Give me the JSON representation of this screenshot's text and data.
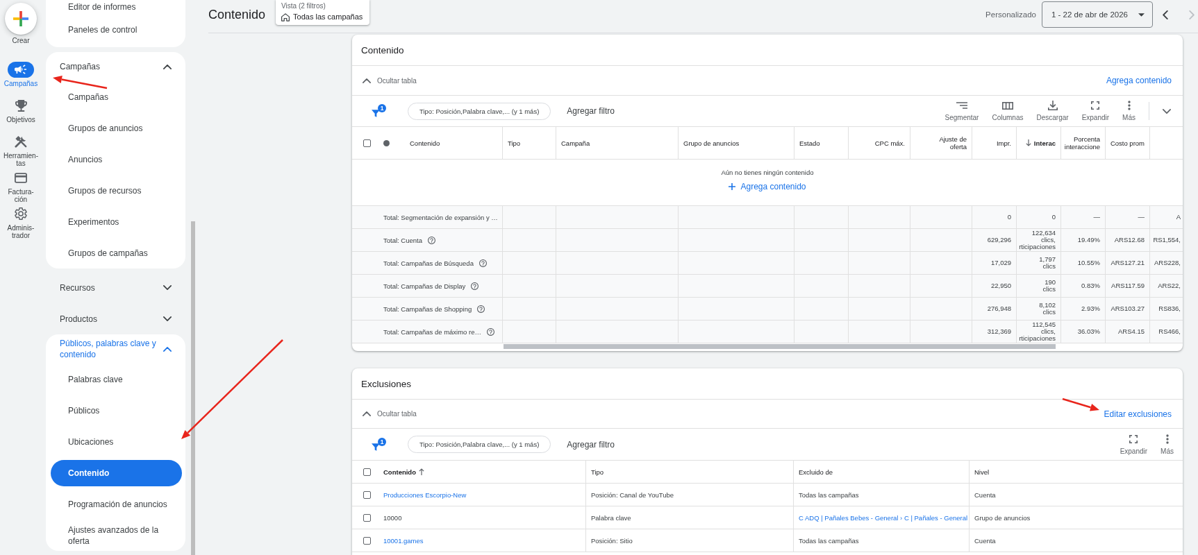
{
  "rail": {
    "create": {
      "label": "Crear"
    },
    "items": [
      {
        "kind": "campaigns",
        "label": "Campañas",
        "selected": true
      },
      {
        "kind": "goals",
        "label": "Objetivos",
        "selected": false
      },
      {
        "kind": "tools",
        "label": "Herramien-\ntas",
        "selected": false
      },
      {
        "kind": "billing",
        "label": "Factura-\nción",
        "selected": false
      },
      {
        "kind": "admin",
        "label": "Adminis-\ntrador",
        "selected": false
      }
    ]
  },
  "sidebar": {
    "sections": [
      {
        "expanded": true,
        "items": [
          {
            "label": "Editor de informes",
            "selected": false
          },
          {
            "label": "Paneles de control",
            "selected": false
          }
        ]
      },
      {
        "label": "Campañas",
        "expanded": true,
        "active": false,
        "items": [
          {
            "label": "Campañas",
            "selected": false
          },
          {
            "label": "Grupos de anuncios",
            "selected": false
          },
          {
            "label": "Anuncios",
            "selected": false
          },
          {
            "label": "Grupos de recursos",
            "selected": false
          },
          {
            "label": "Experimentos",
            "selected": false
          },
          {
            "label": "Grupos de campañas",
            "selected": false
          }
        ]
      },
      {
        "label": "Recursos",
        "expanded": false,
        "active": false
      },
      {
        "label": "Productos",
        "expanded": false,
        "active": false
      },
      {
        "label": "Públicos, palabras clave y contenido",
        "expanded": true,
        "active": true,
        "items": [
          {
            "label": "Palabras clave",
            "selected": false
          },
          {
            "label": "Públicos",
            "selected": false
          },
          {
            "label": "Ubicaciones",
            "selected": false
          },
          {
            "label": "Contenido",
            "selected": true
          },
          {
            "label": "Programación de anuncios",
            "selected": false
          },
          {
            "label": "Ajustes avanzados de la oferta",
            "selected": false
          }
        ]
      }
    ]
  },
  "header": {
    "title": "Contenido",
    "view": {
      "caption": "Vista (2 filtros)",
      "value": "Todas las campañas"
    },
    "date": {
      "preset": "Personalizado",
      "range": "1 - 22 de abr de 2026"
    },
    "prev": {
      "disabled": false
    },
    "next": {
      "disabled": true
    }
  },
  "content_table": {
    "title": "Contenido",
    "toggle": {
      "label": "Ocultar tabla",
      "expanded": true
    },
    "action": "Agrega contenido",
    "filter": {
      "count": "1",
      "chip": "Tipo: Posición,Palabra clave,... (y 1 más)",
      "add": "Agregar filtro"
    },
    "tools": [
      {
        "kind": "segment",
        "label": "Segmentar"
      },
      {
        "kind": "columns",
        "label": "Columnas"
      },
      {
        "kind": "download",
        "label": "Descargar"
      },
      {
        "kind": "expand",
        "label": "Expandir"
      },
      {
        "kind": "more",
        "label": "Más"
      }
    ],
    "select_all": {
      "checked": false
    },
    "columns": [
      {
        "label": "Contenido",
        "kind": "text",
        "sorted": false
      },
      {
        "label": "Tipo",
        "kind": "text",
        "sorted": false
      },
      {
        "label": "Campaña",
        "kind": "text",
        "sorted": false
      },
      {
        "label": "Grupo de anuncios",
        "kind": "text",
        "sorted": false
      },
      {
        "label": "Estado",
        "kind": "text",
        "sorted": false
      },
      {
        "label": "CPC máx.",
        "kind": "metric",
        "sorted": false
      },
      {
        "label": "Ajuste de\noferta",
        "kind": "metric",
        "sorted": false
      },
      {
        "label": "Impr.",
        "kind": "metric",
        "sorted": false
      },
      {
        "label": "Interac",
        "kind": "metric",
        "sorted": true,
        "descending": true
      },
      {
        "label": "Porcenta\ninteraccione",
        "kind": "metric",
        "sorted": false
      },
      {
        "label": "Costo prom",
        "kind": "metric",
        "sorted": false
      }
    ],
    "empty": {
      "message": "Aún no tienes ningún contenido",
      "action": "Agrega contenido"
    },
    "totals": [
      {
        "label": "Total: Segmentación de expansión y …",
        "help": false,
        "metrics": [
          "0",
          "0",
          "—",
          "—",
          "A"
        ]
      },
      {
        "label": "Total: Cuenta",
        "help": true,
        "metrics": [
          "629,296",
          "122,634\nclics,\nrticipaciones",
          "19.49%",
          "ARS12.68",
          "RS1,554,"
        ]
      },
      {
        "label": "Total: Campañas de Búsqueda",
        "help": true,
        "metrics": [
          "17,029",
          "1,797\nclics",
          "10.55%",
          "ARS127.21",
          "ARS228,"
        ]
      },
      {
        "label": "Total: Campañas de Display",
        "help": true,
        "metrics": [
          "22,950",
          "190\nclics",
          "0.83%",
          "ARS117.59",
          "ARS22,"
        ]
      },
      {
        "label": "Total: Campañas de Shopping",
        "help": true,
        "metrics": [
          "276,948",
          "8,102\nclics",
          "2.93%",
          "ARS103.27",
          "RS836,"
        ]
      },
      {
        "label": "Total: Campañas de máximo re…",
        "help": true,
        "metrics": [
          "312,369",
          "112,545\nclics,\nrticipaciones",
          "36.03%",
          "ARS4.15",
          "RS466,"
        ]
      }
    ]
  },
  "exclusions": {
    "title": "Exclusiones",
    "toggle": {
      "label": "Ocultar tabla",
      "expanded": true
    },
    "action": "Editar exclusiones",
    "filter": {
      "count": "1",
      "chip": "Tipo: Posición,Palabra clave,... (y 1 más)",
      "add": "Agregar filtro"
    },
    "tools": [
      {
        "kind": "expand",
        "label": "Expandir"
      },
      {
        "kind": "more",
        "label": "Más"
      }
    ],
    "select_all": {
      "checked": false
    },
    "columns": [
      {
        "label": "Contenido",
        "sorted": true,
        "descending": false
      },
      {
        "label": "Tipo",
        "sorted": false
      },
      {
        "label": "Excluido de",
        "sorted": false
      },
      {
        "label": "Nivel",
        "sorted": false
      }
    ],
    "rows": [
      {
        "checked": false,
        "cells": [
          {
            "text": "Producciones Escorpio-New",
            "link": true
          },
          {
            "text": "Posición: Canal de YouTube",
            "link": false
          },
          {
            "text": "Todas las campañas",
            "link": false
          },
          {
            "text": "Cuenta",
            "link": false
          }
        ]
      },
      {
        "checked": false,
        "cells": [
          {
            "text": "10000",
            "link": false
          },
          {
            "text": "Palabra clave",
            "link": false
          },
          {
            "text": "C ADQ | Pañales Bebes - General › C | Pañales - General",
            "link": true
          },
          {
            "text": "Grupo de anuncios",
            "link": false
          }
        ]
      },
      {
        "checked": false,
        "cells": [
          {
            "text": "10001.games",
            "link": true
          },
          {
            "text": "Posición: Sitio",
            "link": false
          },
          {
            "text": "Todas las campañas",
            "link": false
          },
          {
            "text": "Cuenta",
            "link": false
          }
        ]
      }
    ]
  },
  "annotations": [
    {
      "kind": "arrow"
    },
    {
      "kind": "arrow"
    },
    {
      "kind": "arrow"
    }
  ]
}
